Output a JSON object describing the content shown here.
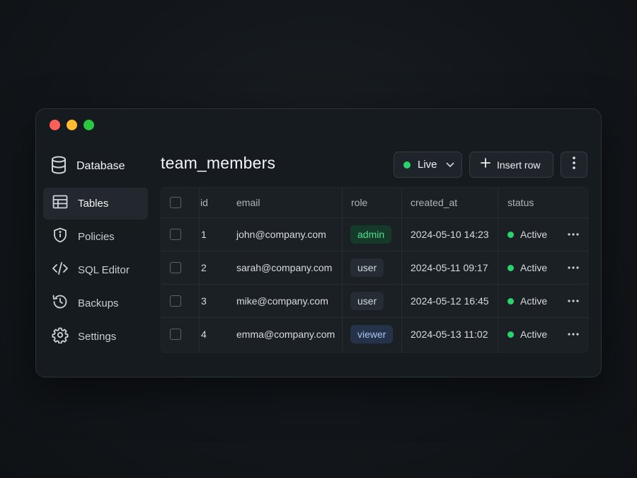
{
  "sidebar": {
    "brand": {
      "label": "Database",
      "icon": "database-icon"
    },
    "items": [
      {
        "label": "Tables",
        "icon": "table-icon",
        "active": true
      },
      {
        "label": "Policies",
        "icon": "shield-icon",
        "active": false
      },
      {
        "label": "SQL Editor",
        "icon": "code-icon",
        "active": false
      },
      {
        "label": "Backups",
        "icon": "history-icon",
        "active": false
      },
      {
        "label": "Settings",
        "icon": "gear-icon",
        "active": false
      }
    ]
  },
  "header": {
    "title": "team_members",
    "live_label": "Live",
    "insert_label": "Insert row"
  },
  "table": {
    "columns": [
      "id",
      "email",
      "role",
      "created_at",
      "status"
    ],
    "rows": [
      {
        "id": "1",
        "email": "john@company.com",
        "role": "admin",
        "created_at": "2024-05-10 14:23",
        "status": "Active"
      },
      {
        "id": "2",
        "email": "sarah@company.com",
        "role": "user",
        "created_at": "2024-05-11 09:17",
        "status": "Active"
      },
      {
        "id": "3",
        "email": "mike@company.com",
        "role": "user",
        "created_at": "2024-05-12 16:45",
        "status": "Active"
      },
      {
        "id": "4",
        "email": "emma@company.com",
        "role": "viewer",
        "created_at": "2024-05-13 11:02",
        "status": "Active"
      }
    ]
  },
  "colors": {
    "accent_green": "#2bd36d",
    "role_admin_bg": "#163a2a",
    "role_admin_fg": "#4fe08f",
    "role_user_bg": "#262c33",
    "role_user_fg": "#d7dbdf",
    "role_viewer_bg": "#24324a",
    "role_viewer_fg": "#a9c4f0"
  }
}
